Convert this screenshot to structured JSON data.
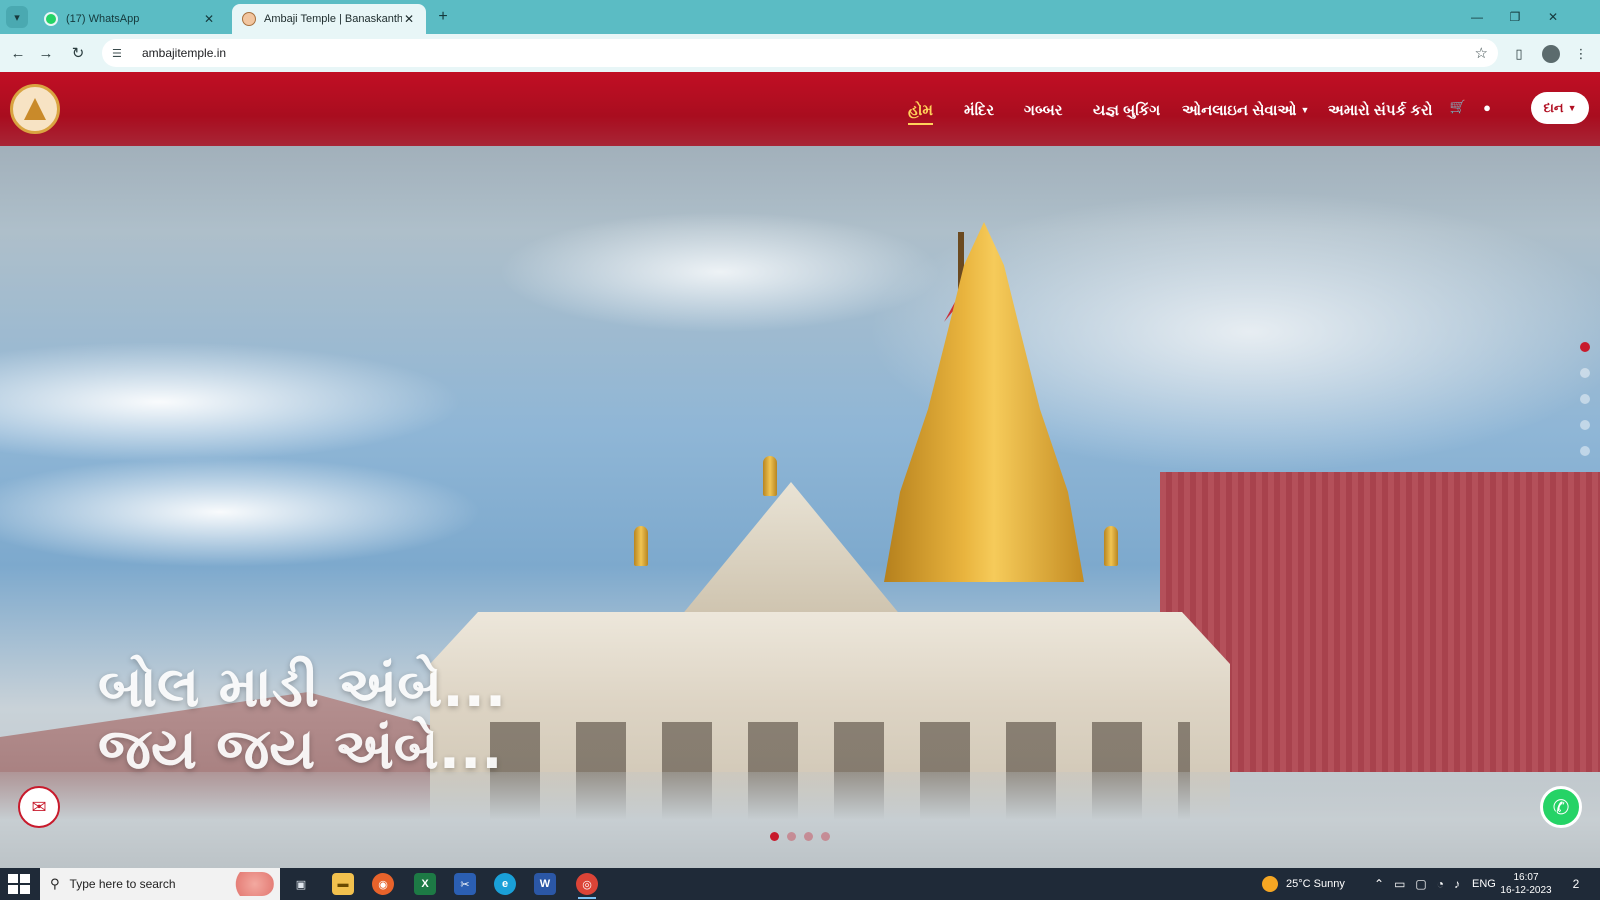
{
  "browser": {
    "tabs": [
      {
        "title": "(17) WhatsApp",
        "active": false
      },
      {
        "title": "Ambaji Temple | Banaskantha, G",
        "active": true
      }
    ],
    "url": "ambajitemple.in"
  },
  "site": {
    "menu": [
      {
        "label": "હોમ",
        "active": true
      },
      {
        "label": "મંદિર"
      },
      {
        "label": "ગબ્બર"
      },
      {
        "label": "યજ્ઞ બુકિંગ"
      },
      {
        "label": "ઓનલાઇન સેવાઓ",
        "dropdown": true
      },
      {
        "label": "અમારો સંપર્ક કરો"
      }
    ],
    "donate_label": "દાન",
    "tagline": [
      "બોલ માડી અંબે...",
      "જય જય અંબે..."
    ],
    "slider": {
      "vertical_total": 5,
      "vertical_active": 1,
      "horizontal_total": 4,
      "horizontal_active": 1
    }
  },
  "taskbar": {
    "search_placeholder": "Type here to search",
    "weather": "25°C  Sunny",
    "language": "ENG",
    "time": "16:07",
    "date": "16-12-2023",
    "notification_count": "2"
  },
  "colors": {
    "header_red": "#c10f24",
    "active_menu": "#ffd25a",
    "whatsapp": "#25d366",
    "chrome_teal": "#5bbcc4"
  },
  "icons": [
    "tab-list-icon",
    "whatsapp-favicon",
    "temple-favicon",
    "close-icon",
    "plus-icon",
    "back-arrow-icon",
    "forward-arrow-icon",
    "reload-icon",
    "site-info-icon",
    "star-icon",
    "side-panel-icon",
    "profile-icon",
    "menu-dots-icon",
    "cart-icon",
    "user-icon",
    "chatbot-icon",
    "whatsapp-icon",
    "windows-start-icon",
    "search-icon",
    "task-view-icon",
    "file-explorer-icon",
    "firefox-icon",
    "excel-icon",
    "snipping-icon",
    "edge-icon",
    "word-icon",
    "chrome-icon"
  ]
}
